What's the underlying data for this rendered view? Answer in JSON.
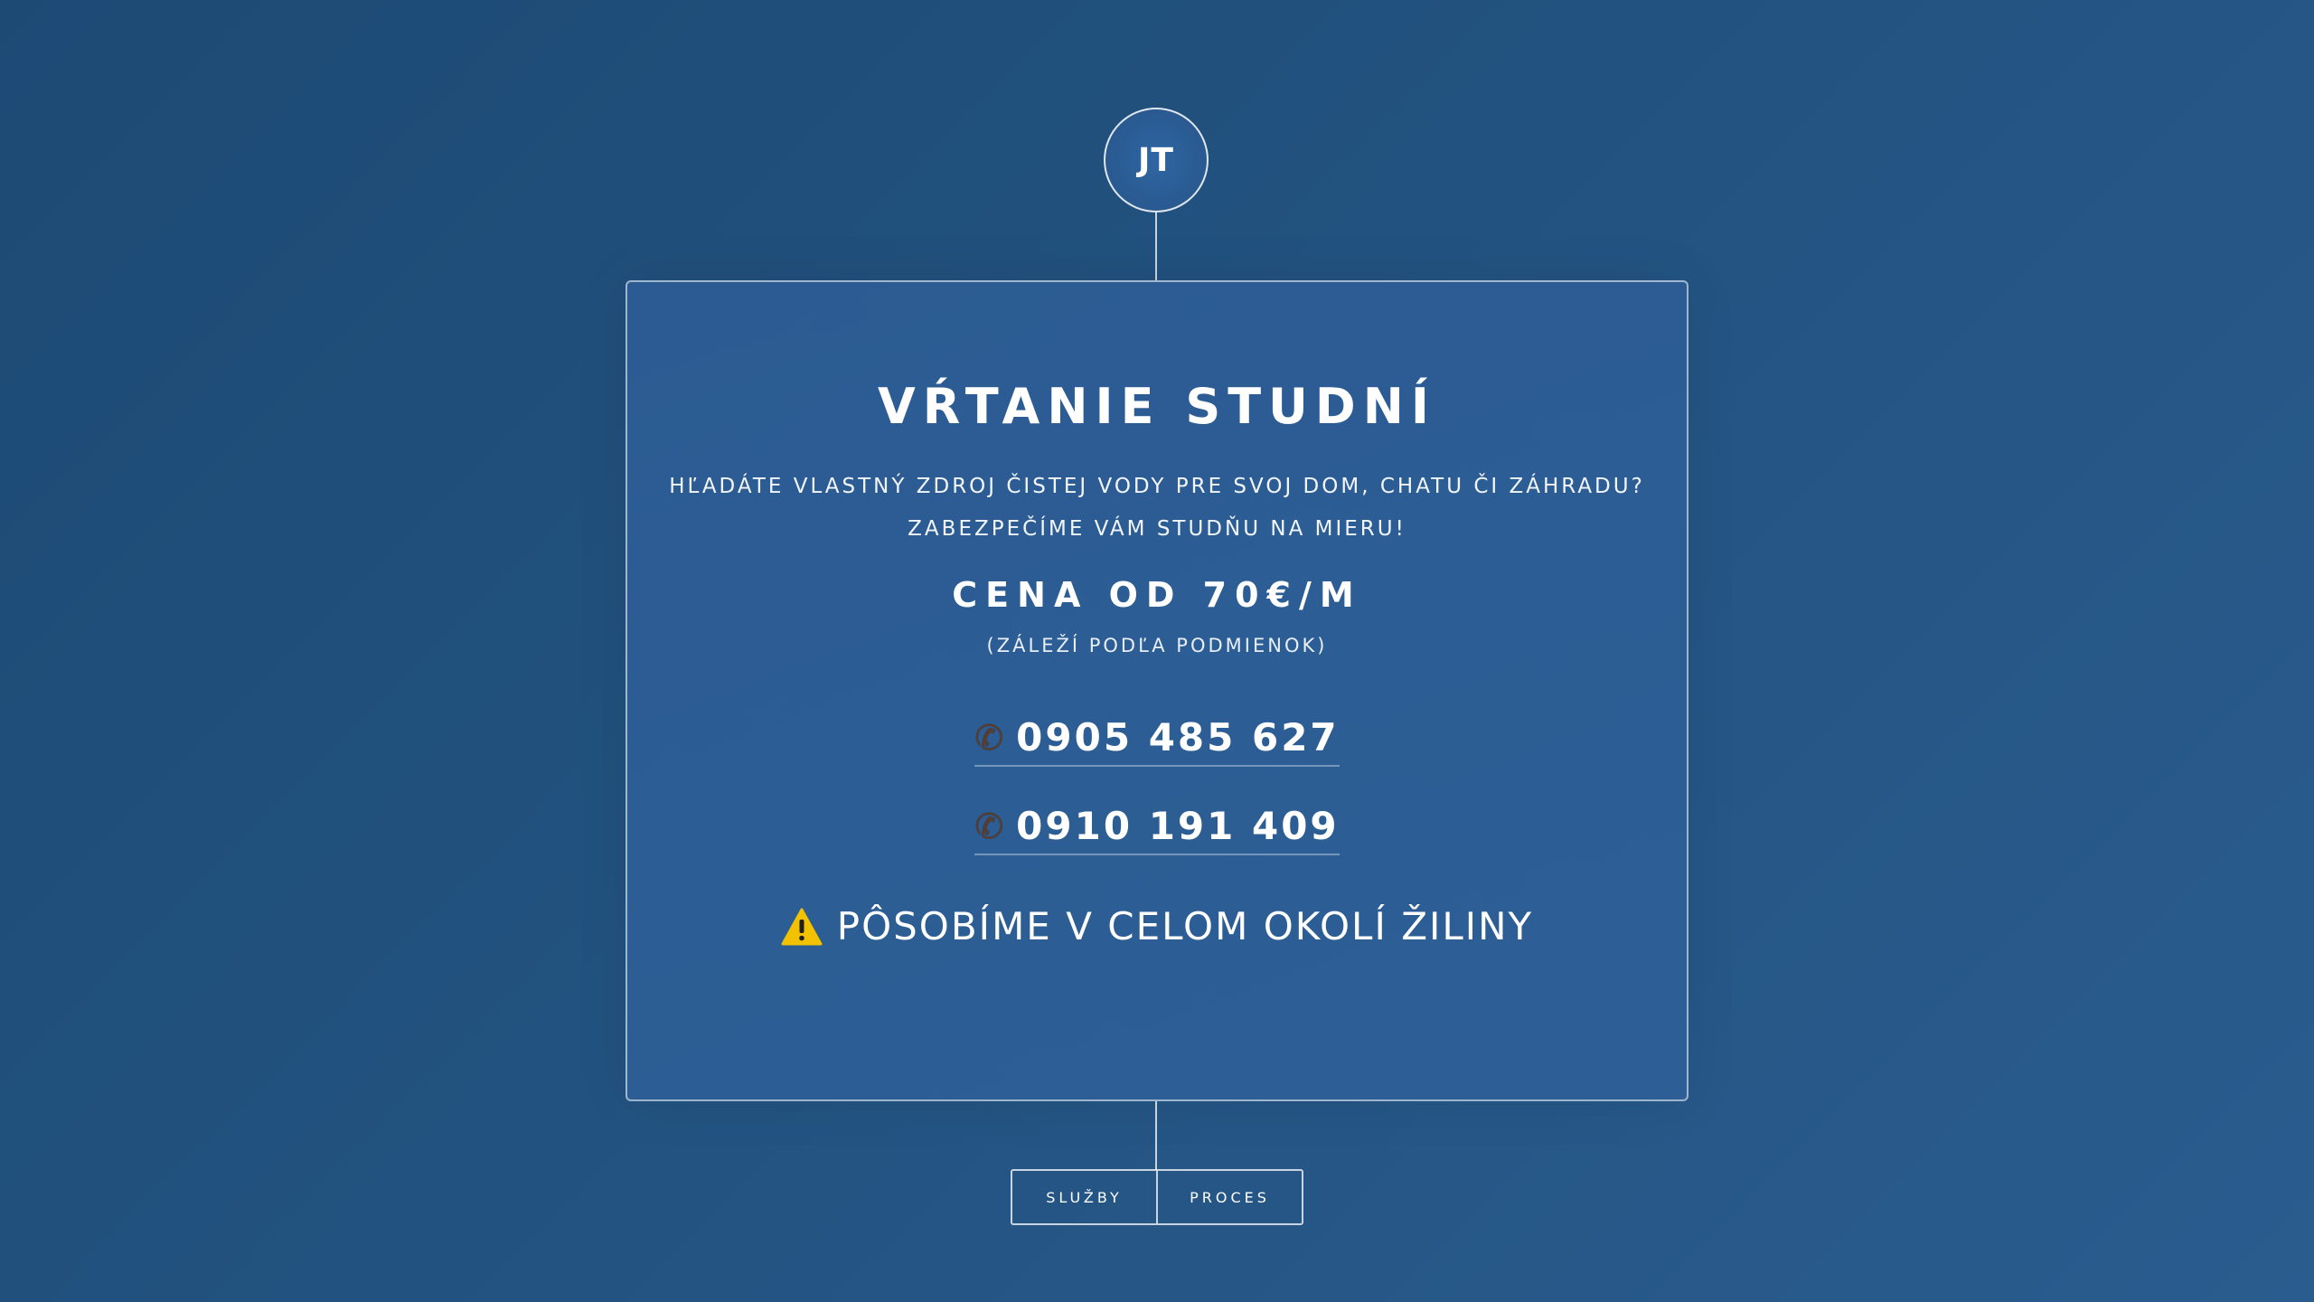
{
  "logo": {
    "initials": "JT"
  },
  "hero": {
    "title": "VŔTANIE STUDNÍ",
    "subtitle_line1": "HĽADÁTE VLASTNÝ ZDROJ ČISTEJ VODY PRE SVOJ DOM, CHATU ČI ZÁHRADU?",
    "subtitle_line2": "ZABEZPEČÍME VÁM STUDŇU NA MIERU!",
    "price": "CENA OD 70€/M",
    "price_note": "(ZÁLEŽÍ PODĽA PODMIENOK)",
    "phones": [
      {
        "icon": "phone-icon",
        "number": "0905 485 627"
      },
      {
        "icon": "phone-icon",
        "number": "0910 191 409"
      }
    ],
    "region_icon": "warning-icon",
    "region": "PÔSOBÍME V CELOM OKOLÍ ŽILINY"
  },
  "nav": {
    "items": [
      "SLUŽBY",
      "PROCES"
    ]
  },
  "colors": {
    "background": "#22527f",
    "card": "#2c5d94",
    "text": "#ffffff",
    "warning": "#f2c100"
  }
}
